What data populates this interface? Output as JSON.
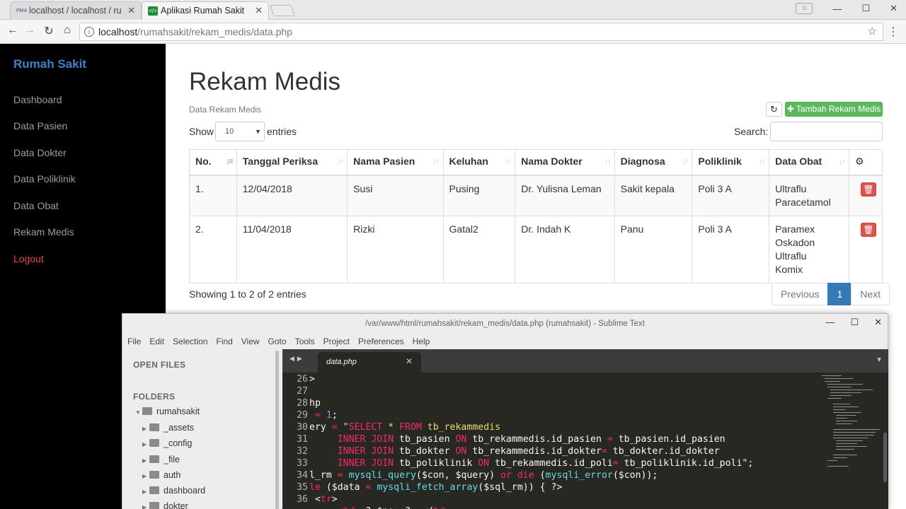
{
  "browser": {
    "tabs": [
      {
        "label": "localhost / localhost / ru",
        "favicon": "pma"
      },
      {
        "label": "Aplikasi Rumah Sakit",
        "favicon": "code"
      }
    ],
    "url_host": "localhost",
    "url_path": "/rumahsakit/rekam_medis/data.php"
  },
  "sidebar": {
    "brand": "Rumah Sakit",
    "items": [
      "Dashboard",
      "Data Pasien",
      "Data Dokter",
      "Data Poliklinik",
      "Data Obat",
      "Rekam Medis"
    ],
    "logout": "Logout"
  },
  "main": {
    "title": "Rekam Medis",
    "subtitle": "Data Rekam Medis",
    "add_button": "Tambah Rekam Medis",
    "show_label": "Show",
    "entries_select": "10",
    "entries_label": "entries",
    "search_label": "Search:",
    "info": "Showing 1 to 2 of 2 entries",
    "pagination": {
      "previous": "Previous",
      "current": "1",
      "next": "Next"
    }
  },
  "table": {
    "columns": [
      "No.",
      "Tanggal Periksa",
      "Nama Pasien",
      "Keluhan",
      "Nama Dokter",
      "Diagnosa",
      "Poliklinik",
      "Data Obat"
    ],
    "rows": [
      {
        "no": "1.",
        "tanggal": "12/04/2018",
        "pasien": "Susi",
        "keluhan": "Pusing",
        "dokter": "Dr. Yulisna Leman",
        "diagnosa": "Sakit kepala",
        "poli": "Poli 3 A",
        "obat": [
          "Ultraflu",
          "Paracetamol"
        ]
      },
      {
        "no": "2.",
        "tanggal": "11/04/2018",
        "pasien": "Rizki",
        "keluhan": "Gatal2",
        "dokter": "Dr. Indah K",
        "diagnosa": "Panu",
        "poli": "Poli 3 A",
        "obat": [
          "Paramex",
          "Oskadon",
          "Ultraflu",
          "Komix"
        ]
      }
    ]
  },
  "editor": {
    "window_title": "/var/www/html/rumahsakit/rekam_medis/data.php (rumahsakit) - Sublime Text",
    "menu": [
      "File",
      "Edit",
      "Selection",
      "Find",
      "View",
      "Goto",
      "Tools",
      "Project",
      "Preferences",
      "Help"
    ],
    "open_files_header": "OPEN FILES",
    "folders_header": "FOLDERS",
    "root_folder": "rumahsakit",
    "folders": [
      "_assets",
      "_config",
      "_file",
      "auth",
      "dashboard",
      "dokter"
    ],
    "active_tab": "data.php",
    "line_numbers": [
      "26",
      "27",
      "28",
      "29",
      "30",
      "31",
      "32",
      "33",
      "34",
      "35",
      "36"
    ]
  },
  "colors": {
    "brand": "#3e82c9",
    "success": "#5cb85c",
    "danger": "#d9534f",
    "primary": "#337ab7",
    "editor_bg": "#272822"
  }
}
